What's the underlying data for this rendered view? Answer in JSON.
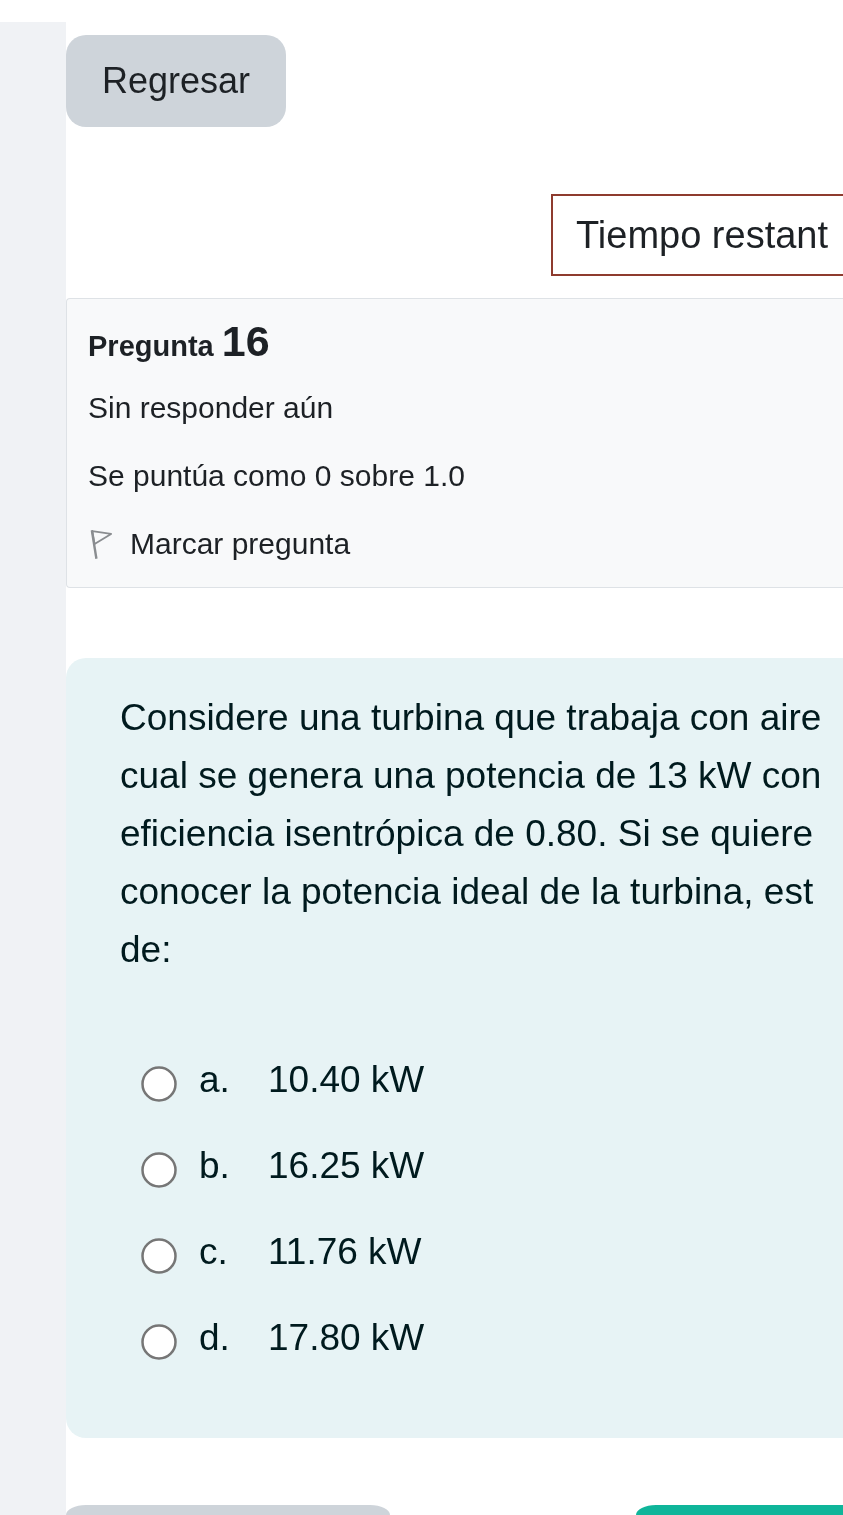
{
  "back_button": {
    "label": "Regresar"
  },
  "timer": {
    "label": "Tiempo restant"
  },
  "question_info": {
    "title": "Pregunta",
    "number": "16",
    "status": "Sin responder aún",
    "grade": "Se puntúa como 0 sobre 1.0",
    "flag": {
      "label": "Marcar pregunta",
      "flagged": false
    }
  },
  "question": {
    "lines": [
      "Considere una turbina que trabaja con aire",
      "cual se genera una potencia de 13 kW con",
      "eficiencia isentrópica de 0.80. Si se quiere",
      "conocer la potencia ideal de la turbina, est",
      "de:"
    ],
    "options": [
      {
        "letter": "a.",
        "text": "10.40 kW",
        "selected": false
      },
      {
        "letter": "b.",
        "text": "16.25 kW",
        "selected": false
      },
      {
        "letter": "c.",
        "text": "11.76 kW",
        "selected": false
      },
      {
        "letter": "d.",
        "text": "17.80 kW",
        "selected": false
      }
    ]
  }
}
